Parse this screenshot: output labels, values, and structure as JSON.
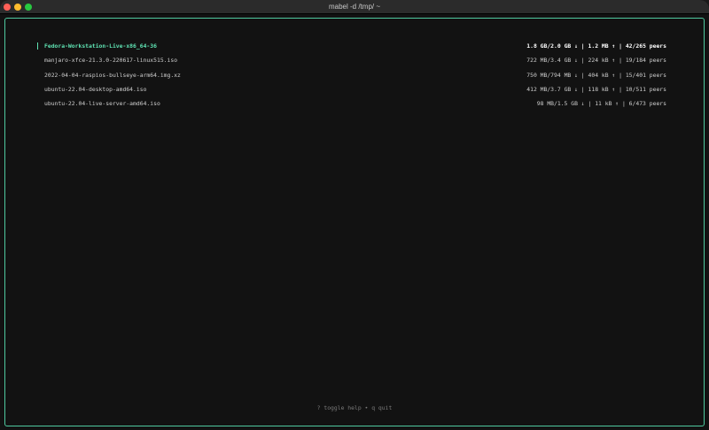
{
  "window": {
    "title": "mabel -d /tmp/ ~"
  },
  "colors": {
    "accent": "#5fe3b3",
    "border": "#4fcaa0",
    "close": "#ff5f57",
    "minimize": "#febc2e",
    "zoom": "#28c840"
  },
  "torrents": [
    {
      "name": "Fedora-Workstation-Live-x86_64-36",
      "stats": "1.8 GB/2.0 GB ↓ | 1.2 MB ↑ | 42/265 peers",
      "selected": true
    },
    {
      "name": "manjaro-xfce-21.3.0-220617-linux515.iso",
      "stats": "722 MB/3.4 GB ↓ | 224 kB ↑ | 19/184 peers",
      "selected": false
    },
    {
      "name": "2022-04-04-raspios-bullseye-arm64.img.xz",
      "stats": "750 MB/794 MB ↓ | 404 kB ↑ | 15/401 peers",
      "selected": false
    },
    {
      "name": "ubuntu-22.04-desktop-amd64.iso",
      "stats": "412 MB/3.7 GB ↓ | 118 kB ↑ | 10/511 peers",
      "selected": false
    },
    {
      "name": "ubuntu-22.04-live-server-amd64.iso",
      "stats": "98 MB/1.5 GB ↓ | 11 kB ↑ | 6/473 peers",
      "selected": false
    }
  ],
  "help": {
    "text": "? toggle help • q quit"
  }
}
